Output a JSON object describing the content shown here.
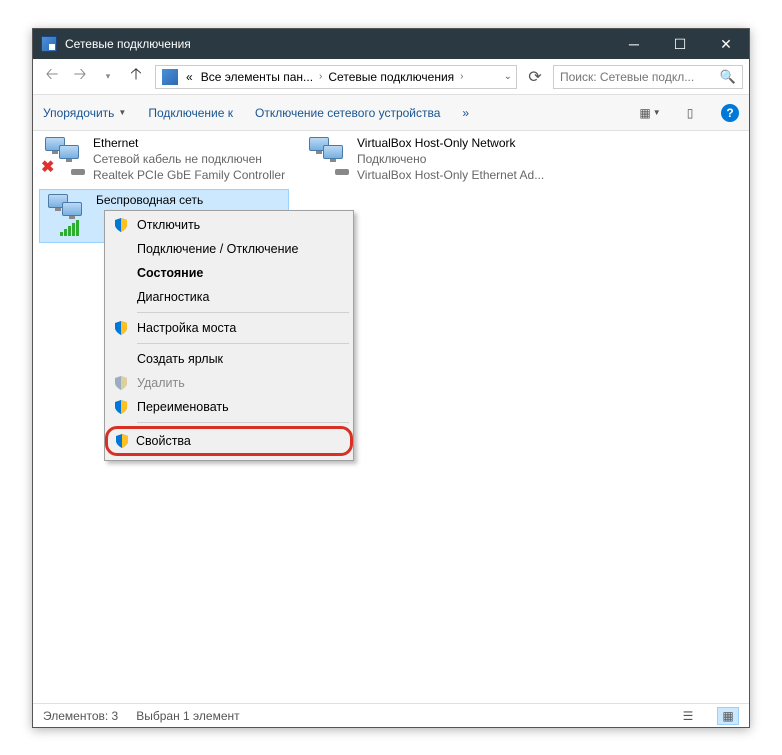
{
  "titlebar": {
    "title": "Сетевые подключения"
  },
  "breadcrumb": {
    "prefix": "«",
    "seg1": "Все элементы пан...",
    "seg2": "Сетевые подключения"
  },
  "search": {
    "placeholder": "Поиск: Сетевые подкл..."
  },
  "toolbar": {
    "organize": "Упорядочить",
    "connect_to": "Подключение к",
    "disable_device": "Отключение сетевого устройства",
    "overflow": "»"
  },
  "connections": {
    "ethernet": {
      "name": "Ethernet",
      "status": "Сетевой кабель не подключен",
      "device": "Realtek PCIe GbE Family Controller"
    },
    "vbox": {
      "name": "VirtualBox Host-Only Network",
      "status": "Подключено",
      "device": "VirtualBox Host-Only Ethernet Ad..."
    },
    "wifi": {
      "name": "Беспроводная сеть"
    }
  },
  "contextmenu": {
    "disable": "Отключить",
    "connect_disconnect": "Подключение / Отключение",
    "status": "Состояние",
    "diagnostics": "Диагностика",
    "bridge": "Настройка моста",
    "shortcut": "Создать ярлык",
    "delete": "Удалить",
    "rename": "Переименовать",
    "properties": "Свойства"
  },
  "statusbar": {
    "elements": "Элементов: 3",
    "selected": "Выбран 1 элемент"
  }
}
